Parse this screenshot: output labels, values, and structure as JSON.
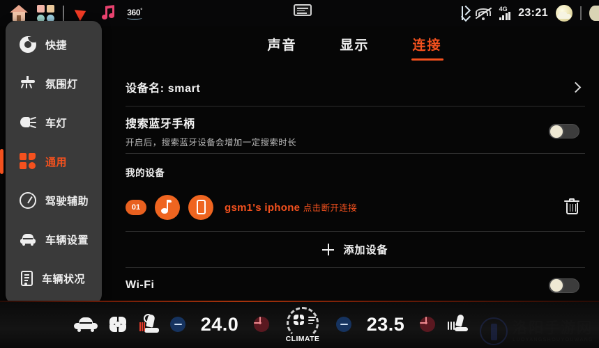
{
  "statusbar": {
    "left_icons": [
      {
        "name": "home-icon",
        "label": "Home"
      },
      {
        "name": "apps-grid-icon",
        "label": "Apps"
      },
      {
        "name": "navigation-icon",
        "label": "Navigation"
      },
      {
        "name": "music-icon",
        "label": "Music"
      },
      {
        "name": "surround-view-360-icon",
        "label": "360"
      }
    ],
    "surround_label": "360",
    "surround_degree": "°",
    "center_icon": "card-icon",
    "right": {
      "bluetooth_icon": "bluetooth-icon",
      "wifi_off_icon": "wifi-off-icon",
      "network_label": "4G",
      "time": "23:21",
      "weather_icon": "sun-cloud-icon"
    }
  },
  "sidebar": {
    "items": [
      {
        "label": "快捷",
        "icon": "shortcut-icon",
        "active": false
      },
      {
        "label": "氛围灯",
        "icon": "ambient-light-icon",
        "active": false
      },
      {
        "label": "车灯",
        "icon": "headlight-icon",
        "active": false
      },
      {
        "label": "通用",
        "icon": "general-settings-icon",
        "active": true
      },
      {
        "label": "驾驶辅助",
        "icon": "driver-assist-icon",
        "active": false
      },
      {
        "label": "车辆设置",
        "icon": "vehicle-settings-icon",
        "active": false
      },
      {
        "label": "车辆状况",
        "icon": "vehicle-status-icon",
        "active": false
      }
    ]
  },
  "tabs": [
    {
      "label": "声音",
      "active": false
    },
    {
      "label": "显示",
      "active": false
    },
    {
      "label": "连接",
      "active": true
    }
  ],
  "content": {
    "device_name_row": {
      "label": "设备名: smart",
      "chevron": "chevron-right-icon"
    },
    "bt_search_row": {
      "title": "搜索蓝牙手柄",
      "subtitle": "开启后，搜索蓝牙设备会增加一定搜索时长",
      "toggle_state": "off"
    },
    "my_devices": {
      "section_title": "我的设备",
      "device": {
        "badge": "01",
        "audio_icon": "music-note-icon",
        "phone_icon": "mobile-phone-icon",
        "name": "gsm1's iphone",
        "action": "点击断开连接",
        "delete_icon": "trash-icon"
      }
    },
    "add_device": {
      "label": "添加设备",
      "icon": "plus-icon"
    },
    "wifi_row": {
      "label": "Wi-Fi",
      "toggle_state": "off"
    }
  },
  "bottombar": {
    "car_icon": "car-icon",
    "fan_icon": "fan-icon",
    "seat_heater_left_icon": "seat-heater-icon",
    "seat_heater_right_icon": "seat-ventilation-icon",
    "left_temp": {
      "minus": "−",
      "value": "24.0",
      "plus": "+"
    },
    "right_temp": {
      "minus": "−",
      "value": "23.5",
      "plus": "+"
    },
    "climate": {
      "label": "CLIMATE"
    }
  },
  "watermark": {
    "cn": "洛阳手游网",
    "en": "LUOYANGSHOUYOUWANG"
  },
  "colors": {
    "accent": "#f4511e",
    "device_orange": "#ef6520",
    "panel_bg": "#3a3a3a",
    "screen_bg": "#060606",
    "text": "#f2f2f2",
    "subtext": "#b9b9b9"
  }
}
